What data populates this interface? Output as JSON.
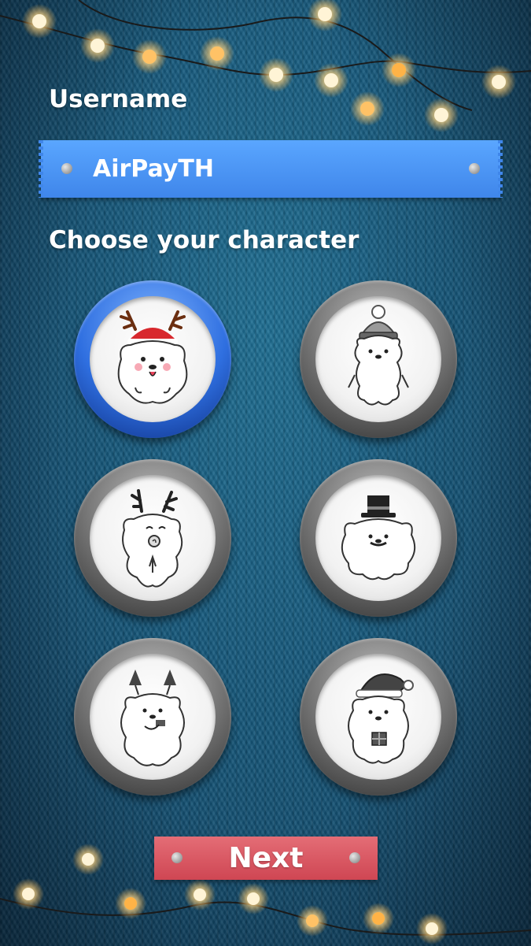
{
  "form": {
    "username_label": "Username",
    "username_value": "AirPayTH",
    "choose_label": "Choose your character"
  },
  "characters": [
    {
      "name": "reindeer-bear",
      "accessory": "antlers with red beanie",
      "selected": true
    },
    {
      "name": "pompom-hat-bear",
      "accessory": "striped pompom hat",
      "selected": false
    },
    {
      "name": "party-horn-bear",
      "accessory": "antlers with party horn",
      "selected": false
    },
    {
      "name": "top-hat-bear",
      "accessory": "top hat",
      "selected": false
    },
    {
      "name": "tree-headband-bear",
      "accessory": "christmas tree headband",
      "selected": false
    },
    {
      "name": "santa-hat-bear",
      "accessory": "santa hat with gift",
      "selected": false
    }
  ],
  "actions": {
    "next_label": "Next"
  },
  "colors": {
    "background": "#16577a",
    "username_bar": "#4a92f2",
    "next_button": "#d9525e",
    "selected_ring": "#2f6fe0",
    "unselected_ring": "#6e6e6e"
  }
}
